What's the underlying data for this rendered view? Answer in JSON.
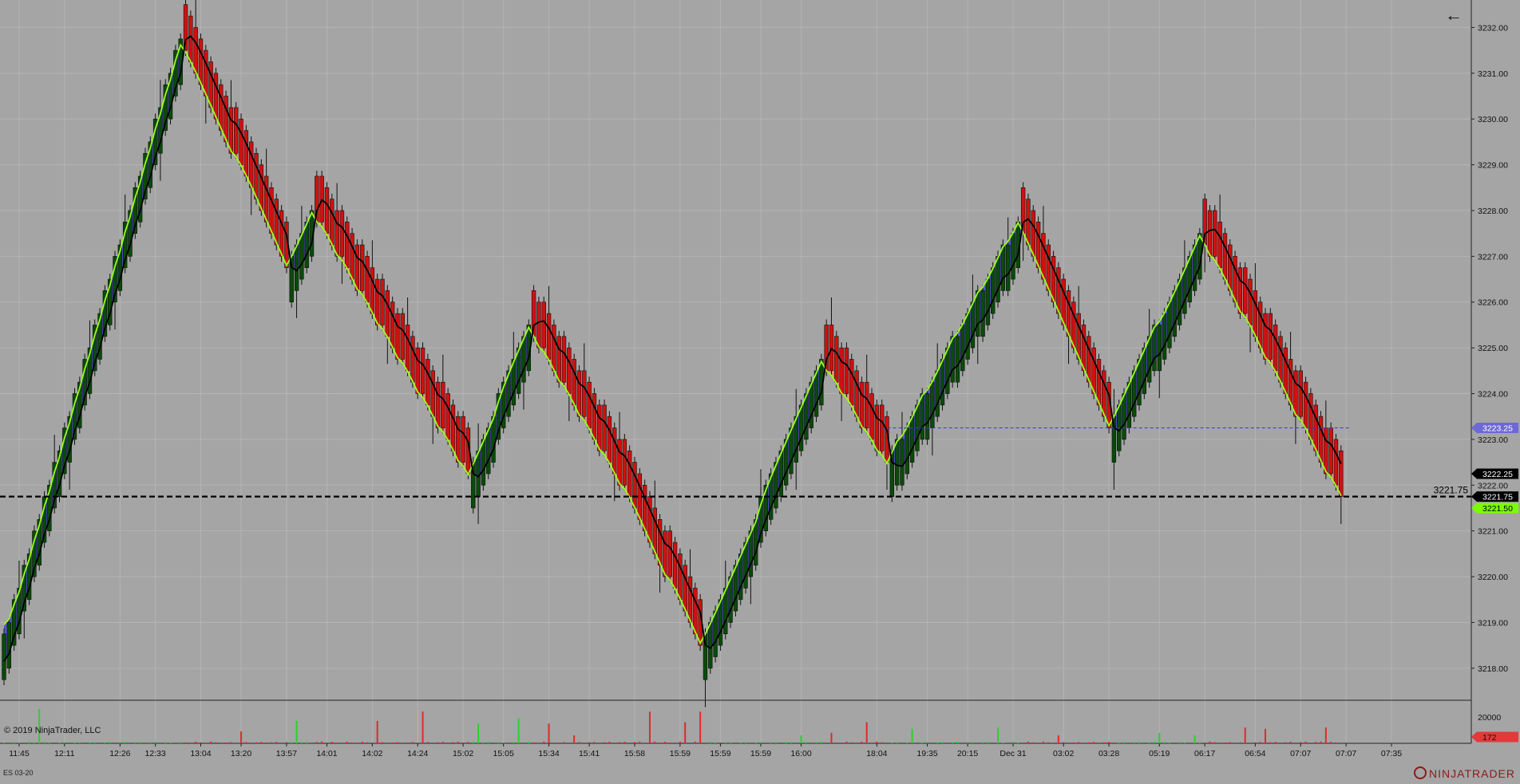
{
  "instrument": "ES 03-20",
  "copyright": "© 2019 NinjaTrader, LLC",
  "brand": "NINJATRADER",
  "back_icon": "arrow-left-icon",
  "chart_data": {
    "type": "candlestick-renko",
    "y_ticks": [
      "3218.00",
      "3219.00",
      "3220.00",
      "3221.00",
      "3222.00",
      "3223.00",
      "3224.00",
      "3225.00",
      "3226.00",
      "3227.00",
      "3228.00",
      "3229.00",
      "3230.00",
      "3231.00",
      "3232.00"
    ],
    "ylim": [
      3217.3,
      3232.6
    ],
    "x_tick_labels": [
      "11:45",
      "12:11",
      "12:26",
      "12:33",
      "13:04",
      "13:20",
      "13:57",
      "14:01",
      "14:02",
      "14:24",
      "15:02",
      "15:05",
      "15:34",
      "15:41",
      "15:58",
      "15:59",
      "15:59",
      "15:59",
      "16:00",
      "18:04",
      "19:35",
      "20:15",
      "Dec 31",
      "03:02",
      "03:28",
      "05:19",
      "06:17",
      "06:54",
      "07:07",
      "07:07",
      "07:35"
    ],
    "x_tick_bar_index": [
      3,
      12,
      23,
      30,
      39,
      47,
      56,
      64,
      73,
      82,
      91,
      99,
      108,
      116,
      125,
      134,
      142,
      150,
      158,
      173,
      183,
      191,
      200,
      210,
      219,
      229,
      238,
      248,
      257,
      266,
      275
    ],
    "total_bars": 281,
    "swing_pivots": [
      [
        0,
        3218.75
      ],
      [
        35,
        3231.75
      ],
      [
        56,
        3226.75
      ],
      [
        61,
        3228.0
      ],
      [
        92,
        3222.25
      ],
      [
        104,
        3225.5
      ],
      [
        125,
        3221.5
      ],
      [
        138,
        3218.5
      ],
      [
        162,
        3224.75
      ],
      [
        175,
        3222.5
      ],
      [
        201,
        3227.75
      ],
      [
        219,
        3223.25
      ],
      [
        237,
        3227.5
      ],
      [
        265,
        3221.75
      ]
    ],
    "horizontal_line": {
      "value": 3221.75,
      "label": "3221.75",
      "style": "dashed",
      "color": "#000000"
    },
    "dotted_line": {
      "value": 3223.25,
      "start_bar": 174,
      "color": "#3a38c8"
    },
    "price_markers": [
      {
        "value": 3223.25,
        "label": "3223.25",
        "bg": "#6e68d6",
        "fg": "#ffffff"
      },
      {
        "value": 3222.25,
        "label": "3222.25",
        "bg": "#000000",
        "fg": "#ffffff"
      },
      {
        "value": 3221.75,
        "label": "3221.75",
        "bg": "#000000",
        "fg": "#ffffff"
      },
      {
        "value": 3221.5,
        "label": "3221.50",
        "bg": "#7cfc00",
        "fg": "#000000"
      }
    ],
    "volume": {
      "tick_label": "20000",
      "last_label": "172",
      "last_bg": "#e23a3a",
      "tick_value": 20000
    },
    "colors": {
      "up_bar": "#0a4a0a",
      "down_bar": "#d01010",
      "blue_fill": "#4747d6",
      "red_fill": "#e8877a",
      "fast_ma": "#000000",
      "slow_ma": "#9aff1a",
      "vol_up": "#2bd12b",
      "vol_down": "#e02a2a"
    }
  }
}
